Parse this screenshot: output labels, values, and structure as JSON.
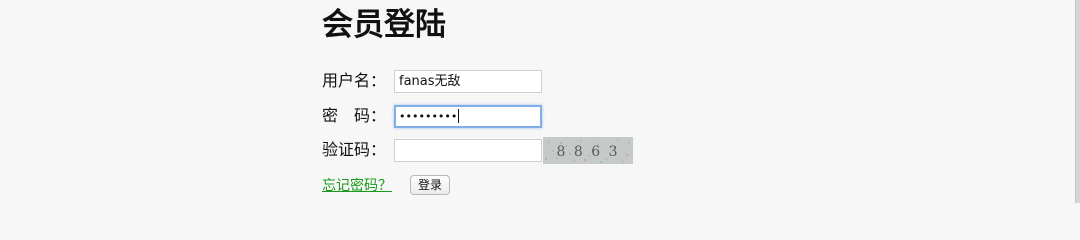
{
  "page": {
    "title": "会员登陆"
  },
  "form": {
    "username_label": "用户名：",
    "username_value": "fanas无敌",
    "password_label": "密　码：",
    "password_value": "•••••••••",
    "captcha_label": "验证码：",
    "captcha_value": "",
    "captcha_text": "8 8 6 3",
    "forgot_link": "忘记密码？",
    "login_button": "登录"
  },
  "colors": {
    "link": "#1a9a1a",
    "focus_ring": "#7faee9",
    "background": "#f7f7f7"
  }
}
